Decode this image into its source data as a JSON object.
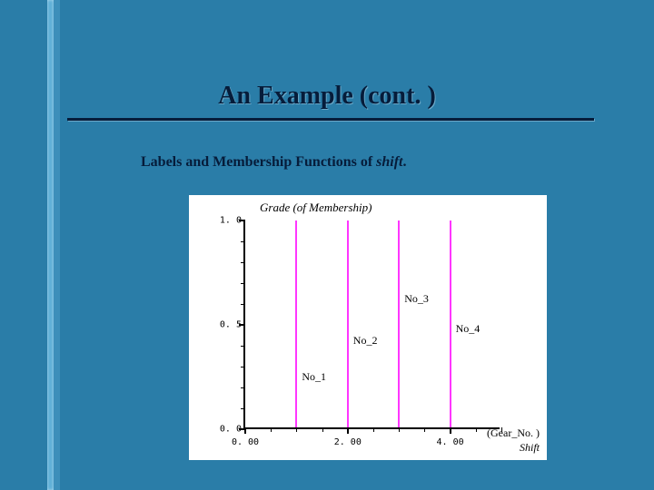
{
  "slide": {
    "title": "An Example (cont. )",
    "subtitle_prefix": "Labels and Membership Functions of ",
    "subtitle_italic": "shift",
    "subtitle_suffix": "."
  },
  "chart_data": {
    "type": "line",
    "title": "Grade (of Membership)",
    "x_axis": {
      "label": "Shift",
      "unit_label": "(Gear_No. )",
      "range": [
        0.0,
        5.0
      ],
      "major_ticks": [
        0.0,
        2.0,
        4.0
      ],
      "minor_step": 0.5,
      "tick_labels": [
        "0. 00",
        "2. 00",
        "4. 00"
      ]
    },
    "y_axis": {
      "range": [
        0.0,
        1.0
      ],
      "major_ticks": [
        0.0,
        0.5,
        1.0
      ],
      "minor_step": 0.1,
      "tick_labels": [
        "0. 0",
        "0. 5",
        "1. 0"
      ]
    },
    "series": [
      {
        "name": "No_1",
        "x": 1.0,
        "value": 1.0
      },
      {
        "name": "No_2",
        "x": 2.0,
        "value": 1.0
      },
      {
        "name": "No_3",
        "x": 3.0,
        "value": 1.0
      },
      {
        "name": "No_4",
        "x": 4.0,
        "value": 1.0
      }
    ],
    "line_color": "#ff36ff",
    "annotations": [
      {
        "text": "No_1",
        "near_x": 1.0,
        "y_frac": 0.25
      },
      {
        "text": "No_2",
        "near_x": 2.0,
        "y_frac": 0.42
      },
      {
        "text": "No_3",
        "near_x": 3.0,
        "y_frac": 0.62
      },
      {
        "text": "No_4",
        "near_x": 4.0,
        "y_frac": 0.48
      }
    ]
  }
}
